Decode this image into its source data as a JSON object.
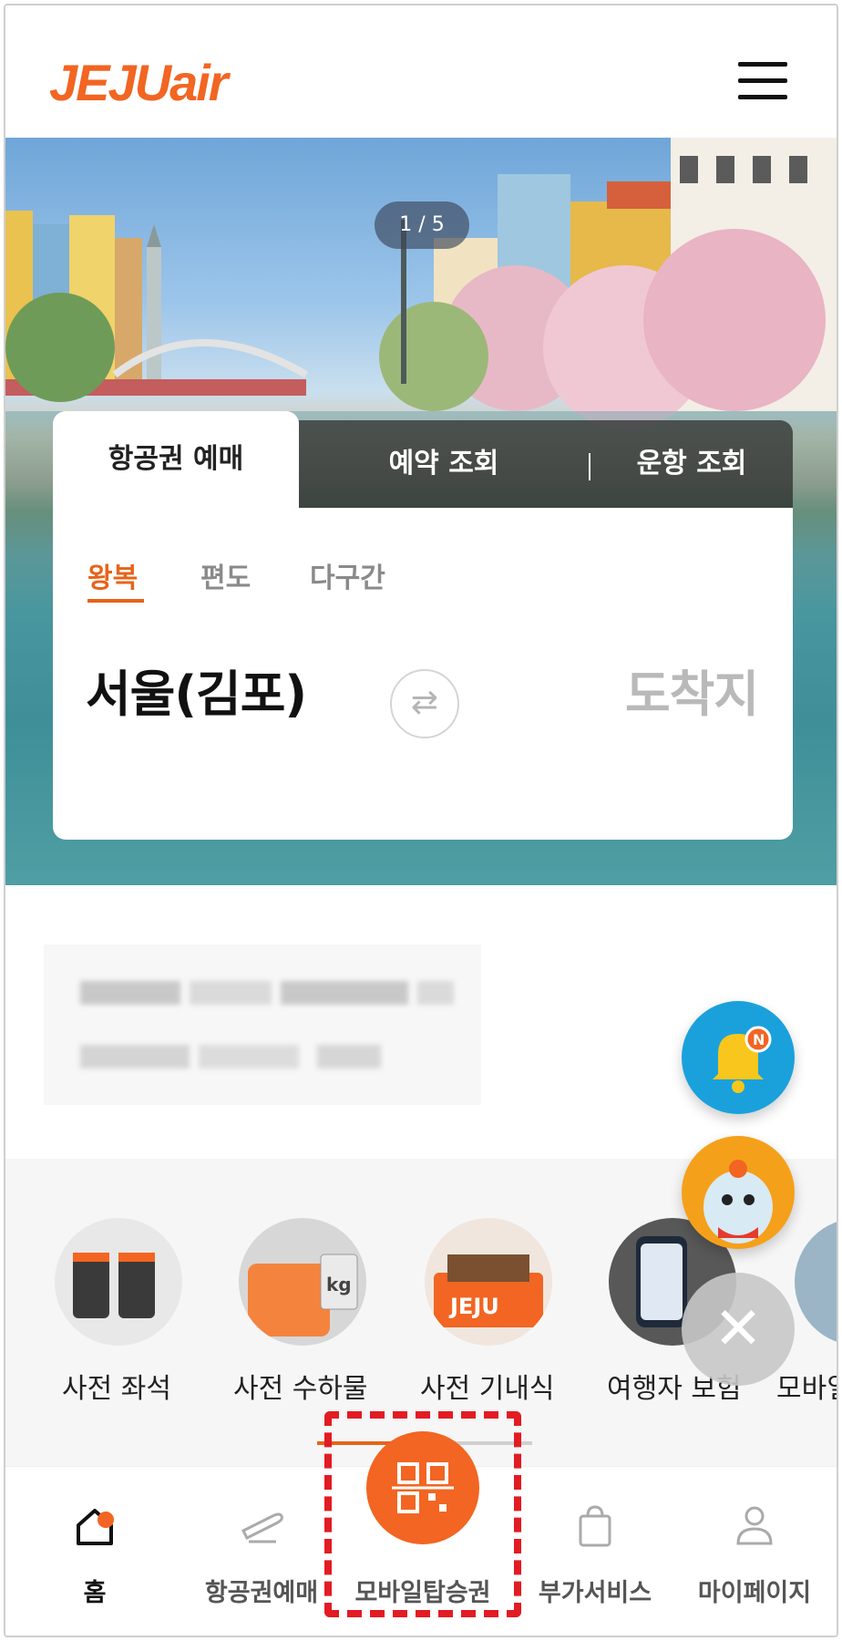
{
  "brand": {
    "logo_text_main": "JEJU",
    "logo_text_air": "air",
    "accent": "#f26522"
  },
  "hero": {
    "pager": "1 / 5"
  },
  "booking": {
    "tabs": [
      "항공권 예매",
      "예약 조회",
      "운항 조회"
    ],
    "trip_types": [
      "왕복",
      "편도",
      "다구간"
    ],
    "origin": "서울(김포)",
    "destination": "도착지"
  },
  "services": [
    {
      "label": "사전 좌석"
    },
    {
      "label": "사전 수하물"
    },
    {
      "label": "사전 기내식"
    },
    {
      "label": "여행자 보험"
    },
    {
      "label": "모바일"
    }
  ],
  "floating": {
    "bell_badge": "N"
  },
  "bottom_nav": [
    {
      "label": "홈",
      "icon": "home-icon"
    },
    {
      "label": "항공권예매",
      "icon": "plane-icon"
    },
    {
      "label": "모바일탑승권",
      "icon": "qr-icon"
    },
    {
      "label": "부가서비스",
      "icon": "bag-icon"
    },
    {
      "label": "마이페이지",
      "icon": "user-icon"
    }
  ]
}
